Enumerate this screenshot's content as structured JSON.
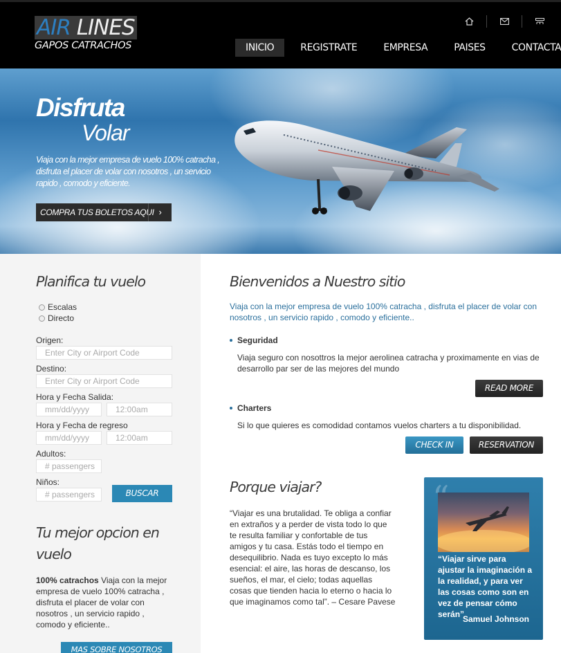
{
  "header": {
    "logo": {
      "word1": "AIR",
      "word2": "LINES",
      "subtitle": "GAPOS CATRACHOS"
    },
    "icons": [
      "home-icon",
      "mail-icon",
      "sitemap-icon"
    ],
    "nav": [
      {
        "label": "INICIO",
        "active": true
      },
      {
        "label": "REGISTRATE",
        "active": false
      },
      {
        "label": "EMPRESA",
        "active": false
      },
      {
        "label": "PAISES",
        "active": false
      },
      {
        "label": "CONTACTANOS",
        "active": false
      }
    ]
  },
  "hero": {
    "title1": "Disfruta",
    "title2": "Volar",
    "text": "Viaja con la mejor empresa de vuelo 100% catracha , disfruta el placer de volar con nosotros , un servicio rapido , comodo y eficiente.",
    "cta": "COMPRA TUS BOLETOS AQUI",
    "cta_icon": "›"
  },
  "planner": {
    "title": "Planifica tu vuelo",
    "options": [
      "Escalas",
      "Directo"
    ],
    "origin_label": "Origen:",
    "origin_placeholder": "Enter City or Airport Code",
    "dest_label": "Destino:",
    "dest_placeholder": "Enter City or Airport Code",
    "depart_label": "Hora y Fecha Salida:",
    "return_label": "Hora y Fecha de regreso",
    "date_placeholder": "mm/dd/yyyy",
    "time_value": "12:00am",
    "adults_label": "Adultos:",
    "children_label": "Niños:",
    "passengers_placeholder": "# passengers",
    "search_button": "BUSCAR"
  },
  "about": {
    "title": "Tu mejor opcion en vuelo",
    "bold": "100% catrachos",
    "text": " Viaja con la mejor empresa de vuelo 100% catracha , disfruta el placer de volar con nosotros , un servicio rapido , comodo y eficiente..",
    "button": "MAS SOBRE NOSOTROS"
  },
  "welcome": {
    "title": "Bienvenidos a Nuestro sitio",
    "intro": "Viaja con la mejor empresa de vuelo 100% catracha , disfruta el placer de volar con nosotros , un servicio rapido , comodo y eficiente..",
    "items": [
      {
        "title": "Seguridad",
        "text": "Viaja seguro con nosottros la mejor aerolinea catracha y proximamente en vias de desarrollo par ser de las mejores del mundo"
      },
      {
        "title": "Charters",
        "text": "Si lo que quieres es comodidad contamos vuelos charters a tu disponibilidad."
      }
    ],
    "read_more": "READ MORE",
    "check_in": "CHECK IN",
    "reservation": "RESERVATION"
  },
  "why": {
    "title": "Porque viajar?",
    "text": "“Viajar es una brutalidad. Te obliga a confiar en extraños y a perder de vista todo lo que te resulta familiar y confortable de tus amigos y tu casa. Estás todo el tiempo en desequilibrio. Nada es tuyo excepto lo más esencial: el aire, las horas de descanso, los sueños, el mar, el cielo; todas aquellas cosas que tienden hacia lo eterno o hacia lo que imaginamos como tal”. – Cesare Pavese"
  },
  "quote": {
    "text": "“Viajar sirve para ajustar la imaginación a la realidad, y para ver las cosas como son en vez de pensar cómo serán”",
    "author": "Samuel Johnson"
  }
}
